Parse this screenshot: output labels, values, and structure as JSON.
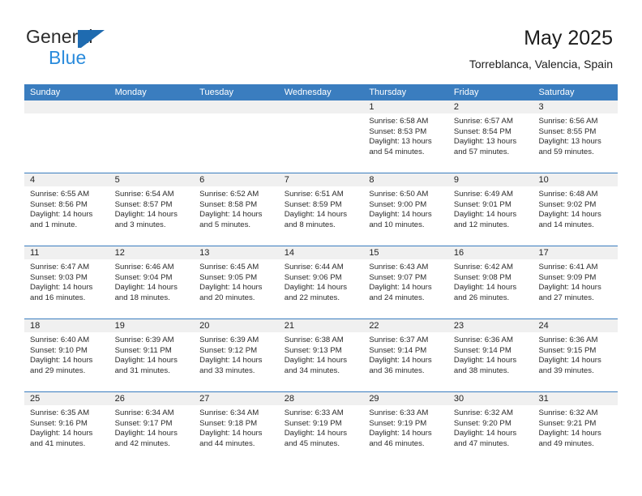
{
  "brand": {
    "name_top": "General",
    "name_bottom": "Blue",
    "logo_color": "#1f6bb0",
    "blue_text_color": "#2a8bdc"
  },
  "header": {
    "title": "May 2025",
    "subtitle": "Torreblanca, Valencia, Spain"
  },
  "theme": {
    "header_blue": "#3a7dbf",
    "daynum_strip": "#f0f0f0",
    "text": "#2b2b2b"
  },
  "calendar": {
    "day_names": [
      "Sunday",
      "Monday",
      "Tuesday",
      "Wednesday",
      "Thursday",
      "Friday",
      "Saturday"
    ],
    "weeks": [
      [
        {
          "day": "",
          "lines": []
        },
        {
          "day": "",
          "lines": []
        },
        {
          "day": "",
          "lines": []
        },
        {
          "day": "",
          "lines": []
        },
        {
          "day": "1",
          "lines": [
            "Sunrise: 6:58 AM",
            "Sunset: 8:53 PM",
            "Daylight: 13 hours",
            "and 54 minutes."
          ]
        },
        {
          "day": "2",
          "lines": [
            "Sunrise: 6:57 AM",
            "Sunset: 8:54 PM",
            "Daylight: 13 hours",
            "and 57 minutes."
          ]
        },
        {
          "day": "3",
          "lines": [
            "Sunrise: 6:56 AM",
            "Sunset: 8:55 PM",
            "Daylight: 13 hours",
            "and 59 minutes."
          ]
        }
      ],
      [
        {
          "day": "4",
          "lines": [
            "Sunrise: 6:55 AM",
            "Sunset: 8:56 PM",
            "Daylight: 14 hours",
            "and 1 minute."
          ]
        },
        {
          "day": "5",
          "lines": [
            "Sunrise: 6:54 AM",
            "Sunset: 8:57 PM",
            "Daylight: 14 hours",
            "and 3 minutes."
          ]
        },
        {
          "day": "6",
          "lines": [
            "Sunrise: 6:52 AM",
            "Sunset: 8:58 PM",
            "Daylight: 14 hours",
            "and 5 minutes."
          ]
        },
        {
          "day": "7",
          "lines": [
            "Sunrise: 6:51 AM",
            "Sunset: 8:59 PM",
            "Daylight: 14 hours",
            "and 8 minutes."
          ]
        },
        {
          "day": "8",
          "lines": [
            "Sunrise: 6:50 AM",
            "Sunset: 9:00 PM",
            "Daylight: 14 hours",
            "and 10 minutes."
          ]
        },
        {
          "day": "9",
          "lines": [
            "Sunrise: 6:49 AM",
            "Sunset: 9:01 PM",
            "Daylight: 14 hours",
            "and 12 minutes."
          ]
        },
        {
          "day": "10",
          "lines": [
            "Sunrise: 6:48 AM",
            "Sunset: 9:02 PM",
            "Daylight: 14 hours",
            "and 14 minutes."
          ]
        }
      ],
      [
        {
          "day": "11",
          "lines": [
            "Sunrise: 6:47 AM",
            "Sunset: 9:03 PM",
            "Daylight: 14 hours",
            "and 16 minutes."
          ]
        },
        {
          "day": "12",
          "lines": [
            "Sunrise: 6:46 AM",
            "Sunset: 9:04 PM",
            "Daylight: 14 hours",
            "and 18 minutes."
          ]
        },
        {
          "day": "13",
          "lines": [
            "Sunrise: 6:45 AM",
            "Sunset: 9:05 PM",
            "Daylight: 14 hours",
            "and 20 minutes."
          ]
        },
        {
          "day": "14",
          "lines": [
            "Sunrise: 6:44 AM",
            "Sunset: 9:06 PM",
            "Daylight: 14 hours",
            "and 22 minutes."
          ]
        },
        {
          "day": "15",
          "lines": [
            "Sunrise: 6:43 AM",
            "Sunset: 9:07 PM",
            "Daylight: 14 hours",
            "and 24 minutes."
          ]
        },
        {
          "day": "16",
          "lines": [
            "Sunrise: 6:42 AM",
            "Sunset: 9:08 PM",
            "Daylight: 14 hours",
            "and 26 minutes."
          ]
        },
        {
          "day": "17",
          "lines": [
            "Sunrise: 6:41 AM",
            "Sunset: 9:09 PM",
            "Daylight: 14 hours",
            "and 27 minutes."
          ]
        }
      ],
      [
        {
          "day": "18",
          "lines": [
            "Sunrise: 6:40 AM",
            "Sunset: 9:10 PM",
            "Daylight: 14 hours",
            "and 29 minutes."
          ]
        },
        {
          "day": "19",
          "lines": [
            "Sunrise: 6:39 AM",
            "Sunset: 9:11 PM",
            "Daylight: 14 hours",
            "and 31 minutes."
          ]
        },
        {
          "day": "20",
          "lines": [
            "Sunrise: 6:39 AM",
            "Sunset: 9:12 PM",
            "Daylight: 14 hours",
            "and 33 minutes."
          ]
        },
        {
          "day": "21",
          "lines": [
            "Sunrise: 6:38 AM",
            "Sunset: 9:13 PM",
            "Daylight: 14 hours",
            "and 34 minutes."
          ]
        },
        {
          "day": "22",
          "lines": [
            "Sunrise: 6:37 AM",
            "Sunset: 9:14 PM",
            "Daylight: 14 hours",
            "and 36 minutes."
          ]
        },
        {
          "day": "23",
          "lines": [
            "Sunrise: 6:36 AM",
            "Sunset: 9:14 PM",
            "Daylight: 14 hours",
            "and 38 minutes."
          ]
        },
        {
          "day": "24",
          "lines": [
            "Sunrise: 6:36 AM",
            "Sunset: 9:15 PM",
            "Daylight: 14 hours",
            "and 39 minutes."
          ]
        }
      ],
      [
        {
          "day": "25",
          "lines": [
            "Sunrise: 6:35 AM",
            "Sunset: 9:16 PM",
            "Daylight: 14 hours",
            "and 41 minutes."
          ]
        },
        {
          "day": "26",
          "lines": [
            "Sunrise: 6:34 AM",
            "Sunset: 9:17 PM",
            "Daylight: 14 hours",
            "and 42 minutes."
          ]
        },
        {
          "day": "27",
          "lines": [
            "Sunrise: 6:34 AM",
            "Sunset: 9:18 PM",
            "Daylight: 14 hours",
            "and 44 minutes."
          ]
        },
        {
          "day": "28",
          "lines": [
            "Sunrise: 6:33 AM",
            "Sunset: 9:19 PM",
            "Daylight: 14 hours",
            "and 45 minutes."
          ]
        },
        {
          "day": "29",
          "lines": [
            "Sunrise: 6:33 AM",
            "Sunset: 9:19 PM",
            "Daylight: 14 hours",
            "and 46 minutes."
          ]
        },
        {
          "day": "30",
          "lines": [
            "Sunrise: 6:32 AM",
            "Sunset: 9:20 PM",
            "Daylight: 14 hours",
            "and 47 minutes."
          ]
        },
        {
          "day": "31",
          "lines": [
            "Sunrise: 6:32 AM",
            "Sunset: 9:21 PM",
            "Daylight: 14 hours",
            "and 49 minutes."
          ]
        }
      ]
    ]
  }
}
